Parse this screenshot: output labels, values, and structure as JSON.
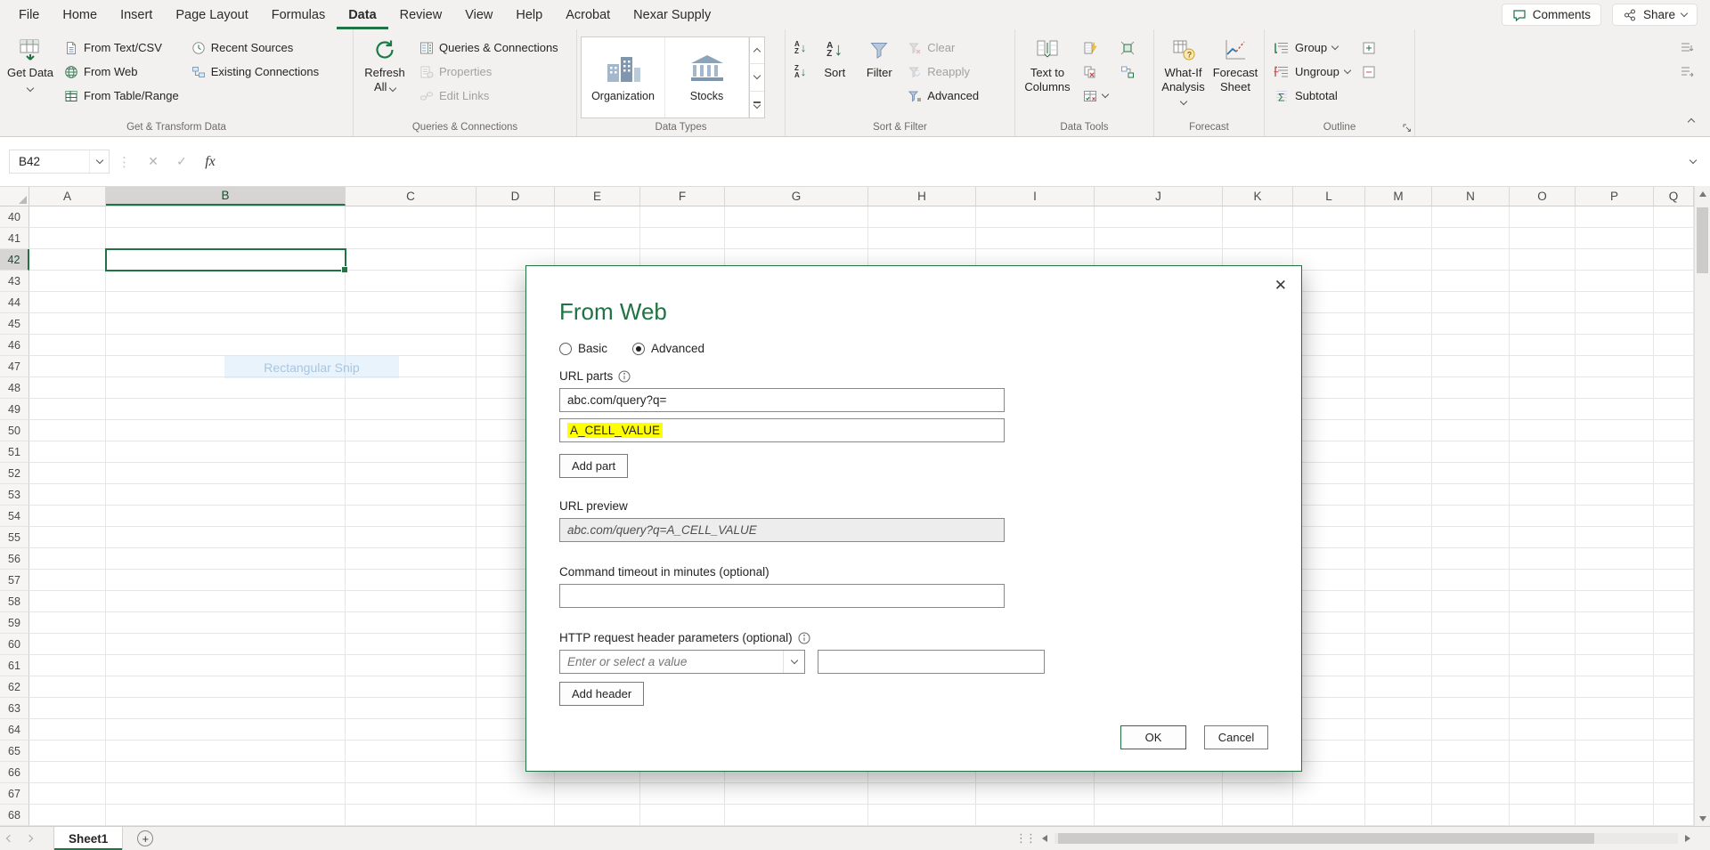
{
  "colors": {
    "accent_green": "#217346",
    "highlight_yellow": "#ffff00"
  },
  "icons": {
    "close": "✕",
    "check": "✓",
    "dots": "⋮",
    "grip": "⋮⋮",
    "fx": "fx",
    "plus": "+",
    "down_arrow": "↓",
    "letter_a": "A",
    "letter_z": "Z",
    "sigma": "Σ",
    "question": "?"
  },
  "app": {
    "tabs": [
      "File",
      "Home",
      "Insert",
      "Page Layout",
      "Formulas",
      "Data",
      "Review",
      "View",
      "Help",
      "Acrobat",
      "Nexar Supply"
    ],
    "active_tab": "Data",
    "comments_label": "Comments",
    "share_label": "Share"
  },
  "ribbon": {
    "get_transform": {
      "title": "Get & Transform Data",
      "get_data": "Get Data",
      "from_text_csv": "From Text/CSV",
      "from_web": "From Web",
      "from_table_range": "From Table/Range",
      "recent_sources": "Recent Sources",
      "existing_connections": "Existing Connections"
    },
    "queries": {
      "title": "Queries & Connections",
      "refresh_all": "Refresh All",
      "queries_connections": "Queries & Connections",
      "properties": "Properties",
      "edit_links": "Edit Links"
    },
    "data_types": {
      "title": "Data Types",
      "items": [
        "Organization",
        "Stocks"
      ]
    },
    "sort_filter": {
      "title": "Sort & Filter",
      "sort": "Sort",
      "filter": "Filter",
      "clear": "Clear",
      "reapply": "Reapply",
      "advanced": "Advanced"
    },
    "data_tools": {
      "title": "Data Tools",
      "text_to_columns": "Text to Columns"
    },
    "forecast": {
      "title": "Forecast",
      "what_if_analysis": "What-If Analysis",
      "forecast_sheet": "Forecast Sheet"
    },
    "outline": {
      "title": "Outline",
      "group": "Group",
      "ungroup": "Ungroup",
      "subtotal": "Subtotal"
    }
  },
  "formula_bar": {
    "name_box": "B42"
  },
  "grid": {
    "columns": [
      "A",
      "B",
      "C",
      "D",
      "E",
      "F",
      "G",
      "H",
      "I",
      "J",
      "K",
      "L",
      "M",
      "N",
      "O",
      "P",
      "Q"
    ],
    "row_start": 40,
    "row_end": 68,
    "selected": {
      "cell": "B42",
      "column": "B",
      "row": 42
    },
    "snip_label": "Rectangular Snip"
  },
  "dialog": {
    "title": "From Web",
    "basic_label": "Basic",
    "advanced_label": "Advanced",
    "url_parts_label": "URL parts",
    "url_part_1": "abc.com/query?q=",
    "url_part_2": "A_CELL_VALUE",
    "add_part_label": "Add part",
    "url_preview_label": "URL preview",
    "url_preview_value": "abc.com/query?q=A_CELL_VALUE",
    "timeout_label": "Command timeout in minutes (optional)",
    "http_headers_label": "HTTP request header parameters (optional)",
    "header_name_placeholder": "Enter or select a value",
    "add_header_label": "Add header",
    "ok_label": "OK",
    "cancel_label": "Cancel"
  },
  "sheet_bar": {
    "sheets": [
      "Sheet1"
    ],
    "active_sheet": "Sheet1"
  }
}
